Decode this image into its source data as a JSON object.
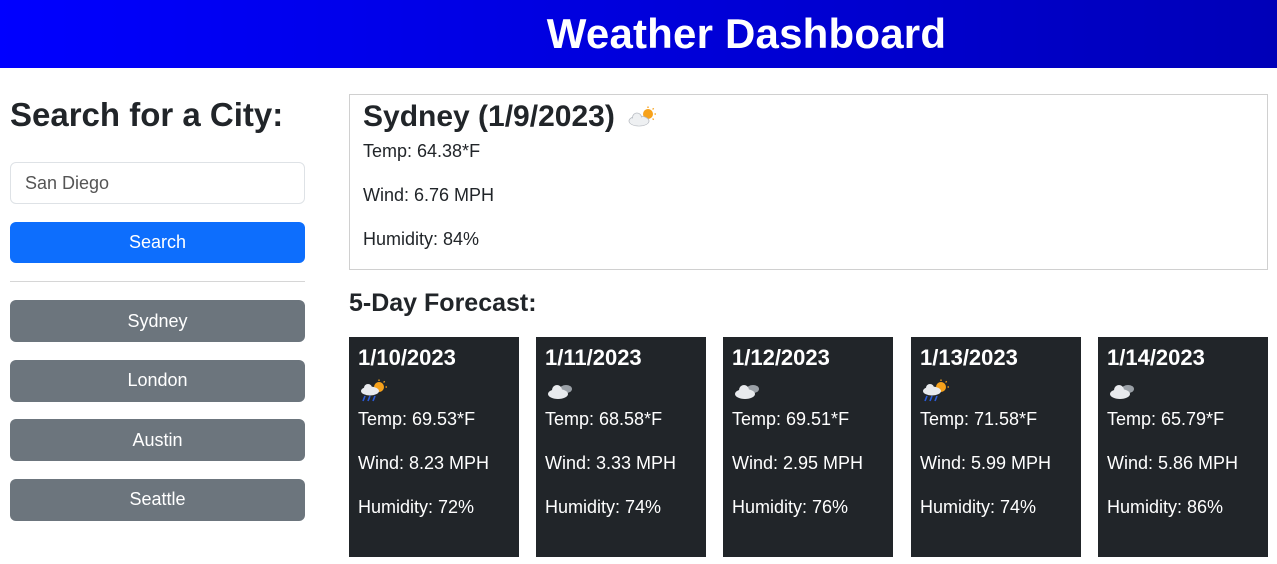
{
  "header": {
    "title": "Weather Dashboard"
  },
  "sidebar": {
    "heading": "Search for a City:",
    "search_value": "San Diego",
    "search_button": "Search",
    "history": [
      "Sydney",
      "London",
      "Austin",
      "Seattle"
    ]
  },
  "current": {
    "title": "Sydney (1/9/2023)",
    "icon": "partly-cloudy-icon",
    "temp": "Temp: 64.38*F",
    "wind": "Wind: 6.76 MPH",
    "humidity": "Humidity: 84%"
  },
  "forecast": {
    "heading": "5-Day Forecast:",
    "days": [
      {
        "date": "1/10/2023",
        "icon": "rain-sun-icon",
        "temp": "Temp: 69.53*F",
        "wind": "Wind: 8.23 MPH",
        "humidity": "Humidity: 72%"
      },
      {
        "date": "1/11/2023",
        "icon": "cloud-icon",
        "temp": "Temp: 68.58*F",
        "wind": "Wind: 3.33 MPH",
        "humidity": "Humidity: 74%"
      },
      {
        "date": "1/12/2023",
        "icon": "cloud-icon",
        "temp": "Temp: 69.51*F",
        "wind": "Wind: 2.95 MPH",
        "humidity": "Humidity: 76%"
      },
      {
        "date": "1/13/2023",
        "icon": "rain-sun-icon",
        "temp": "Temp: 71.58*F",
        "wind": "Wind: 5.99 MPH",
        "humidity": "Humidity: 74%"
      },
      {
        "date": "1/14/2023",
        "icon": "cloud-icon",
        "temp": "Temp: 65.79*F",
        "wind": "Wind: 5.86 MPH",
        "humidity": "Humidity: 86%"
      }
    ]
  }
}
